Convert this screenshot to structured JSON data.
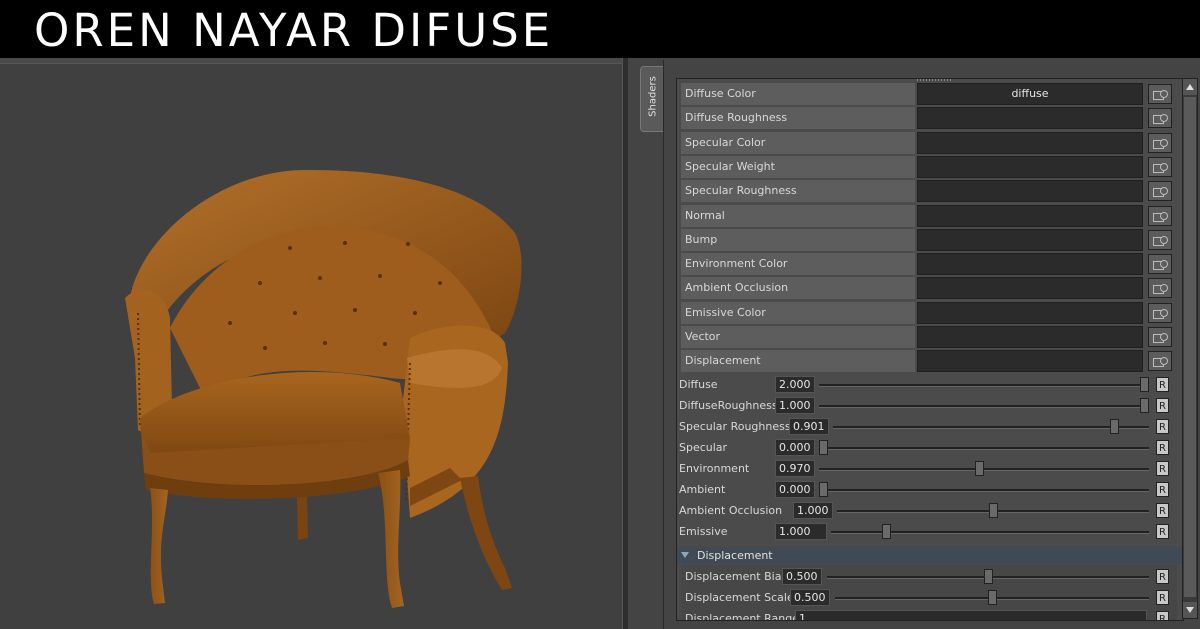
{
  "title": "OREN NAYAR DIFUSE",
  "panel": {
    "tab": "Shaders",
    "connections": [
      {
        "label": "Diffuse Color",
        "value": "diffuse"
      },
      {
        "label": "Diffuse Roughness",
        "value": ""
      },
      {
        "label": "Specular Color",
        "value": ""
      },
      {
        "label": "Specular Weight",
        "value": ""
      },
      {
        "label": "Specular Roughness",
        "value": ""
      },
      {
        "label": "Normal",
        "value": ""
      },
      {
        "label": "Bump",
        "value": ""
      },
      {
        "label": "Environment Color",
        "value": ""
      },
      {
        "label": "Ambient Occlusion",
        "value": ""
      },
      {
        "label": "Emissive Color",
        "value": ""
      },
      {
        "label": "Vector",
        "value": ""
      },
      {
        "label": "Displacement",
        "value": ""
      }
    ],
    "sliders": [
      {
        "label": "Diffuse",
        "value": "2.000",
        "level": 1.0
      },
      {
        "label": "DiffuseRoughness",
        "value": "1.000",
        "level": 1.0
      },
      {
        "label": "Specular Roughness",
        "value": "0.901",
        "level": 0.901
      },
      {
        "label": "Specular",
        "value": "0.000",
        "level": 0.0
      },
      {
        "label": "Environment",
        "value": "0.970",
        "level": 0.485
      },
      {
        "label": "Ambient",
        "value": "0.000",
        "level": 0.0
      },
      {
        "label": "Ambient Occlusion",
        "value": "1.000",
        "level": 0.5
      },
      {
        "label": "Emissive",
        "value": "1.000",
        "level": 0.165
      }
    ],
    "displacement": {
      "header": "Displacement",
      "sliders": [
        {
          "label": "Displacement Bias",
          "value": "0.500",
          "level": 0.5
        },
        {
          "label": "Displacement Scale",
          "value": "0.500",
          "level": 0.5
        },
        {
          "label": "Displacement Range",
          "value": "1"
        }
      ]
    },
    "reset_label": "R"
  },
  "colors": {
    "chair": "#9a5c1c",
    "chair_shadow": "#6e3e0e",
    "viewport_bg": "#404040"
  }
}
